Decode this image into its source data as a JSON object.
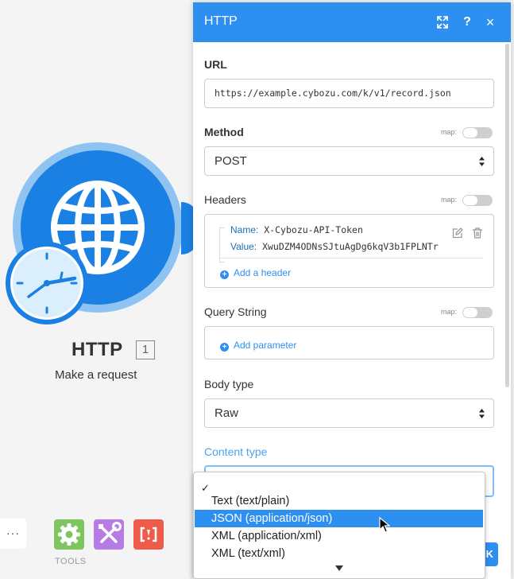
{
  "module": {
    "title": "HTTP",
    "badge": "1",
    "subtitle": "Make a request",
    "icon": "globe-icon",
    "trigger_icon": "clock-icon"
  },
  "toolbar": {
    "more_label": "···",
    "tools_label": "TOOLS",
    "tools": [
      {
        "icon": "gear-icon",
        "color": "#7cc55f"
      },
      {
        "icon": "wrench-screwdriver-icon",
        "color": "#b67be4"
      },
      {
        "icon": "bracket-icon",
        "color": "#ee5b4b"
      }
    ]
  },
  "panel": {
    "title": "HTTP",
    "header_icons": [
      "expand-icon",
      "help-icon",
      "close-icon"
    ],
    "help_label": "?",
    "close_label": "×",
    "map_label": "map:",
    "url": {
      "label": "URL",
      "value": "https://example.cybozu.com/k/v1/record.json"
    },
    "method": {
      "label": "Method",
      "value": "POST"
    },
    "headers": {
      "label": "Headers",
      "items": [
        {
          "name_label": "Name:",
          "name": "X-Cybozu-API-Token",
          "value_label": "Value:",
          "value": "XwuDZM4ODNsSJtuAgDg6kqV3b1FPLNTr"
        }
      ],
      "add_label": "Add a header"
    },
    "query_string": {
      "label": "Query String",
      "add_label": "Add parameter"
    },
    "body_type": {
      "label": "Body type",
      "value": "Raw"
    },
    "content_type": {
      "label": "Content type",
      "value": ""
    },
    "ok_label": "K"
  },
  "dropdown": {
    "check": "✓",
    "options": [
      {
        "label": "",
        "checked": true
      },
      {
        "label": "Text (text/plain)"
      },
      {
        "label": "JSON (application/json)",
        "highlighted": true
      },
      {
        "label": "XML (application/xml)"
      },
      {
        "label": "XML (text/xml)"
      }
    ]
  },
  "colors": {
    "accent": "#2d8ff0",
    "module_blue": "#1a80e4",
    "canvas": "#f4f4f4"
  }
}
